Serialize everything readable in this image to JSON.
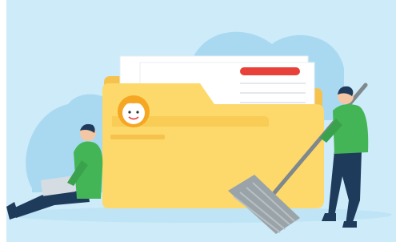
{
  "illustration": {
    "subject": "folder-cleanup",
    "icons": [
      "folder-icon",
      "broom-icon",
      "face-badge-icon"
    ],
    "colors": {
      "background": "#cdebf8",
      "cloud": "#a9d9f1",
      "folder_back": "#f5c24e",
      "folder_front": "#fcd96a",
      "folder_tab": "#f8cc55",
      "paper": "#ffffff",
      "accent_red": "#e8413a",
      "badge_orange": "#f5a623",
      "shirt_green": "#43b556",
      "pants_navy": "#1f3b5c",
      "broom_gray": "#9aa3a8"
    }
  }
}
